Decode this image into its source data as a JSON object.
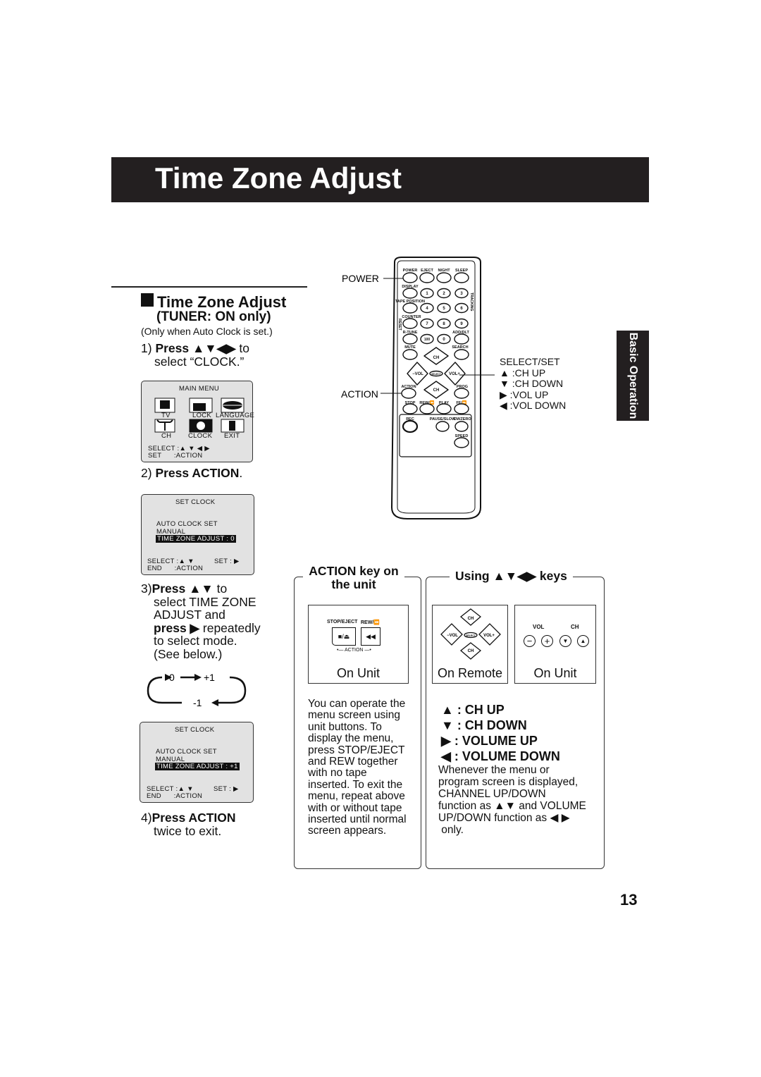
{
  "page_title": "Time Zone Adjust",
  "side_tab": "Basic Operation",
  "page_number": "13",
  "section": {
    "title": "Time Zone Adjust",
    "subtitle": "(TUNER: ON only)",
    "note": "(Only when Auto Clock is set.)"
  },
  "steps": {
    "s1_num": "1)",
    "s1_bold": "Press ▲▼◀▶",
    "s1_rest": " to",
    "s1_line2": "select “CLOCK.”",
    "s2_num": "2)",
    "s2_bold": "Press ACTION",
    "s2_rest": ".",
    "s3_num": "3)",
    "s3_bold": "Press ▲▼",
    "s3_rest": " to",
    "s3_l2": "select TIME ZONE",
    "s3_l3": "ADJUST and",
    "s3_l4_bold": "press ▶",
    "s3_l4_rest": " repeatedly",
    "s3_l5": "to select mode.",
    "s3_l6": "(See below.)",
    "s4_num": "4)",
    "s4_bold": "Press ACTION",
    "s4_l2": "twice to exit."
  },
  "cycle": {
    "a": "0",
    "b": "+1",
    "c": "-1"
  },
  "main_menu": {
    "title": "MAIN MENU",
    "items": [
      "TV",
      "LOCK",
      "LANGUAGE",
      "CH",
      "CLOCK",
      "EXIT"
    ],
    "select": "SELECT :▲ ▼ ◀ ▶",
    "set": "SET      :ACTION"
  },
  "screen1": {
    "title": "SET  CLOCK",
    "l1": "AUTO  CLOCK  SET",
    "l2": "MANUAL",
    "l3": "TIME  ZONE  ADJUST  : 0",
    "select": "SELECT :▲  ▼",
    "set": "SET : ▶",
    "end": "END      :ACTION"
  },
  "screen2": {
    "title": "SET  CLOCK",
    "l1": "AUTO  CLOCK  SET",
    "l2": "MANUAL",
    "l3": "TIME  ZONE  ADJUST  : +1",
    "select": "SELECT :▲  ▼",
    "set": "SET : ▶",
    "end": "END      :ACTION"
  },
  "remote": {
    "callout_power": "POWER",
    "callout_action": "ACTION",
    "select_set": {
      "title": "SELECT/SET",
      "lines": [
        "▲ :CH UP",
        "▼ :CH DOWN",
        "▶ :VOL UP",
        "◀ :VOL DOWN"
      ]
    },
    "labels": {
      "power": "POWER",
      "eject": "EJECT",
      "night": "NIGHT",
      "sleep": "SLEEP",
      "display": "DISPLAY",
      "tape_position": "TAPE POSITION",
      "counter": "COUNTER",
      "rtune": "R-TUNE",
      "add_dlt": "ADD/DLT",
      "mute": "MUTE",
      "search": "SEARCH",
      "action": "ACTION",
      "prog": "PROG",
      "stop": "STOP",
      "rew": "REW/⏪",
      "play": "PLAY",
      "ff": "FF/⏩",
      "rec": "REC",
      "pause": "PAUSE/SLOW",
      "cmzero": "CM/ZERO",
      "speed": "SPEED",
      "tracking": "TRACKING",
      "reset": "RESET",
      "ch": "CH",
      "vol_minus": "−VOL",
      "vol_plus": "VOL+",
      "select": "SELECT"
    },
    "digits": [
      "1",
      "2",
      "3",
      "4",
      "5",
      "6",
      "7",
      "8",
      "9",
      "100",
      "0"
    ]
  },
  "action_box": {
    "heading_l1": "ACTION key on",
    "heading_l2": "the unit",
    "stop_eject": "STOP/EJECT",
    "rew": "REW/⏪",
    "action": "•— ACTION —•",
    "caption": "On Unit",
    "text": [
      "You can operate the",
      "menu screen using",
      "unit buttons. To",
      "display the menu,",
      "press STOP/EJECT",
      "and REW together",
      "with no tape",
      "inserted. To exit the",
      "menu, repeat above",
      "with or without tape",
      "inserted until normal",
      "screen appears."
    ]
  },
  "keys_box": {
    "heading": "Using ▲▼◀▶ keys",
    "remote_caption": "On Remote",
    "unit_caption": "On Unit",
    "vol": "VOL",
    "ch": "CH",
    "keys": [
      "▲ : CH UP",
      "▼ : CH DOWN",
      "▶ : VOLUME UP",
      "◀ : VOLUME DOWN"
    ],
    "text": [
      "Whenever the menu or",
      "program screen is displayed,",
      "CHANNEL UP/DOWN",
      "function as ▲▼ and VOLUME",
      "UP/DOWN function as ◀ ▶",
      " only."
    ]
  }
}
